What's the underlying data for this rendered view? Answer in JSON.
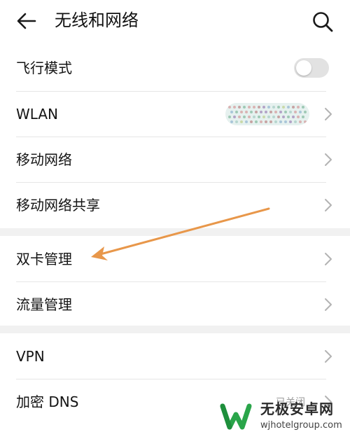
{
  "header": {
    "title": "无线和网络",
    "back_icon": "arrow-left-icon",
    "search_icon": "search-icon"
  },
  "rows": [
    {
      "label": "飞行模式",
      "control": "toggle",
      "toggle_state": "off"
    },
    {
      "label": "WLAN",
      "control": "chevron",
      "value": "(obscured network name)"
    },
    {
      "label": "移动网络",
      "control": "chevron"
    },
    {
      "label": "移动网络共享",
      "control": "chevron"
    },
    {
      "label": "双卡管理",
      "control": "chevron"
    },
    {
      "label": "流量管理",
      "control": "chevron"
    },
    {
      "label": "VPN",
      "control": "chevron"
    },
    {
      "label": "加密 DNS",
      "control": "chevron",
      "value": "已关闭"
    }
  ],
  "annotation": {
    "type": "arrow",
    "color": "#e8974a",
    "points_to": "双卡管理"
  },
  "watermark": {
    "name": "无极安卓网",
    "url": "wjhotelgroup.com",
    "logo_icon": "w-logo-icon",
    "logo_color": "#2aa54a"
  },
  "colors": {
    "section_gap": "#f1f1f1",
    "divider": "#e6e6e6",
    "chevron": "#b3b3b3",
    "toggle_off": "#e2e2e2"
  }
}
